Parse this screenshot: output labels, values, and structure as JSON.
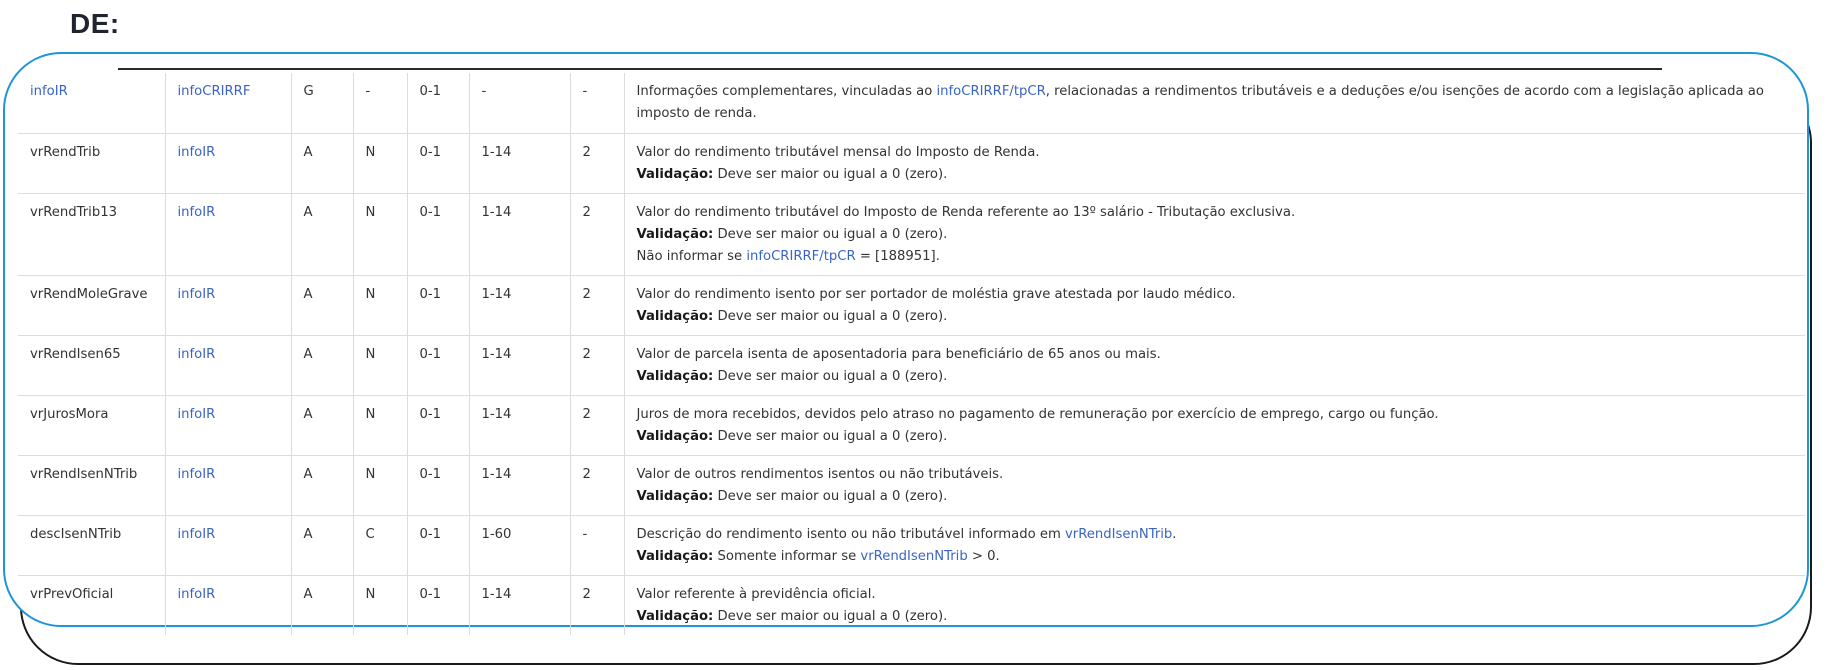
{
  "heading": "DE:",
  "rows": [
    {
      "name": "infoIR",
      "name_link": true,
      "parent": "infoCRIRRF",
      "type": "G",
      "datatype": "-",
      "occurrence": "0-1",
      "size": "-",
      "decimals": "-",
      "desc": [
        {
          "t": "Informações complementares, vinculadas ao "
        },
        {
          "t": "infoCRIRRF/tpCR",
          "link": true
        },
        {
          "t": ", relacionadas a rendimentos tributáveis e a deduções e/ou isenções de acordo com a legislação aplicada ao imposto de renda."
        }
      ]
    },
    {
      "name": "vrRendTrib",
      "name_link": false,
      "parent": "infoIR",
      "type": "A",
      "datatype": "N",
      "occurrence": "0-1",
      "size": "1-14",
      "decimals": "2",
      "desc": [
        {
          "t": "Valor do rendimento tributável mensal do Imposto de Renda."
        },
        {
          "br": true
        },
        {
          "t": "Validação:",
          "bold": true
        },
        {
          "t": " Deve ser maior ou igual a 0 (zero)."
        }
      ]
    },
    {
      "name": "vrRendTrib13",
      "name_link": false,
      "parent": "infoIR",
      "type": "A",
      "datatype": "N",
      "occurrence": "0-1",
      "size": "1-14",
      "decimals": "2",
      "desc": [
        {
          "t": "Valor do rendimento tributável do Imposto de Renda referente ao 13º salário - Tributação exclusiva."
        },
        {
          "br": true
        },
        {
          "t": "Validação:",
          "bold": true
        },
        {
          "t": " Deve ser maior ou igual a 0 (zero)."
        },
        {
          "br": true
        },
        {
          "t": "Não informar se "
        },
        {
          "t": "infoCRIRRF/tpCR",
          "link": true
        },
        {
          "t": " = [188951]."
        }
      ]
    },
    {
      "name": "vrRendMoleGrave",
      "name_link": false,
      "parent": "infoIR",
      "type": "A",
      "datatype": "N",
      "occurrence": "0-1",
      "size": "1-14",
      "decimals": "2",
      "desc": [
        {
          "t": "Valor do rendimento isento por ser portador de moléstia grave atestada por laudo médico."
        },
        {
          "br": true
        },
        {
          "t": "Validação:",
          "bold": true
        },
        {
          "t": " Deve ser maior ou igual a 0 (zero)."
        }
      ]
    },
    {
      "name": "vrRendIsen65",
      "name_link": false,
      "parent": "infoIR",
      "type": "A",
      "datatype": "N",
      "occurrence": "0-1",
      "size": "1-14",
      "decimals": "2",
      "desc": [
        {
          "t": "Valor de parcela isenta de aposentadoria para beneficiário de 65 anos ou mais."
        },
        {
          "br": true
        },
        {
          "t": "Validação:",
          "bold": true
        },
        {
          "t": " Deve ser maior ou igual a 0 (zero)."
        }
      ]
    },
    {
      "name": "vrJurosMora",
      "name_link": false,
      "parent": "infoIR",
      "type": "A",
      "datatype": "N",
      "occurrence": "0-1",
      "size": "1-14",
      "decimals": "2",
      "desc": [
        {
          "t": "Juros de mora recebidos, devidos pelo atraso no pagamento de remuneração por exercício de emprego, cargo ou função."
        },
        {
          "br": true
        },
        {
          "t": "Validação:",
          "bold": true
        },
        {
          "t": " Deve ser maior ou igual a 0 (zero)."
        }
      ]
    },
    {
      "name": "vrRendIsenNTrib",
      "name_link": false,
      "parent": "infoIR",
      "type": "A",
      "datatype": "N",
      "occurrence": "0-1",
      "size": "1-14",
      "decimals": "2",
      "desc": [
        {
          "t": "Valor de outros rendimentos isentos ou não tributáveis."
        },
        {
          "br": true
        },
        {
          "t": "Validação:",
          "bold": true
        },
        {
          "t": " Deve ser maior ou igual a 0 (zero)."
        }
      ]
    },
    {
      "name": "descIsenNTrib",
      "name_link": false,
      "parent": "infoIR",
      "type": "A",
      "datatype": "C",
      "occurrence": "0-1",
      "size": "1-60",
      "decimals": "-",
      "desc": [
        {
          "t": "Descrição do rendimento isento ou não tributável informado em "
        },
        {
          "t": "vrRendIsenNTrib",
          "link": true
        },
        {
          "t": "."
        },
        {
          "br": true
        },
        {
          "t": "Validação:",
          "bold": true
        },
        {
          "t": " Somente informar se "
        },
        {
          "t": "vrRendIsenNTrib",
          "link": true
        },
        {
          "t": " > 0."
        }
      ]
    },
    {
      "name": "vrPrevOficial",
      "name_link": false,
      "parent": "infoIR",
      "type": "A",
      "datatype": "N",
      "occurrence": "0-1",
      "size": "1-14",
      "decimals": "2",
      "desc": [
        {
          "t": "Valor referente à previdência oficial."
        },
        {
          "br": true
        },
        {
          "t": "Validação:",
          "bold": true
        },
        {
          "t": " Deve ser maior ou igual a 0 (zero)."
        }
      ]
    }
  ]
}
